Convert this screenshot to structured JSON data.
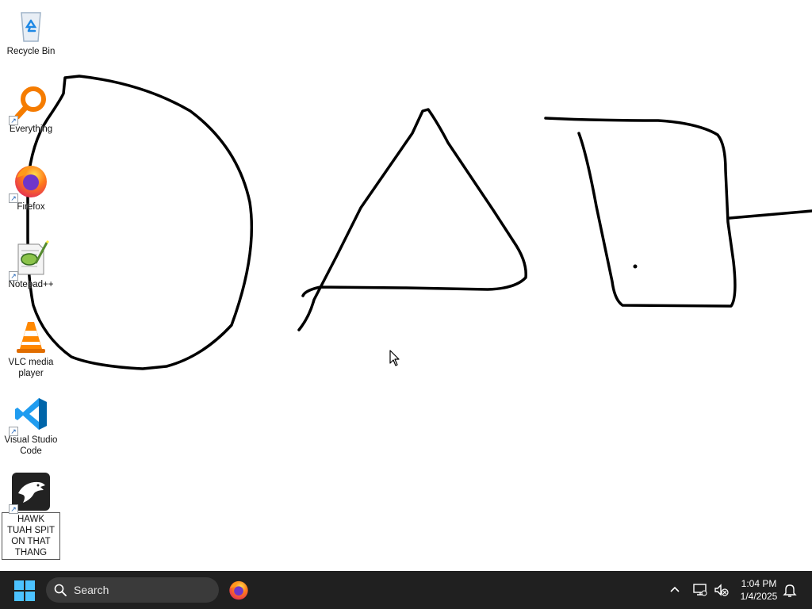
{
  "desktop": {
    "icons": [
      {
        "label": "Recycle Bin",
        "icon": "recycle-bin-icon"
      },
      {
        "label": "Everything",
        "icon": "everything-search-icon"
      },
      {
        "label": "Firefox",
        "icon": "firefox-icon"
      },
      {
        "label": "Notepad++",
        "icon": "notepad-plus-plus-icon"
      },
      {
        "label": "VLC media player",
        "icon": "vlc-cone-icon"
      },
      {
        "label": "Visual Studio Code",
        "icon": "vscode-icon"
      },
      {
        "label": "HAWK TUAH SPIT ON THAT THANG",
        "icon": "hawk-app-icon"
      }
    ],
    "drawing": {
      "shapes": [
        "freehand circle",
        "freehand triangle",
        "freehand square"
      ],
      "stroke_color": "#000000"
    }
  },
  "taskbar": {
    "search_label": "Search",
    "clock_time": "1:04 PM",
    "clock_date": "1/4/2025",
    "pinned": [
      "firefox-icon"
    ],
    "tray_icons": [
      "chevron-up-icon",
      "network-icon",
      "volume-muted-icon",
      "notification-bell-icon"
    ]
  }
}
